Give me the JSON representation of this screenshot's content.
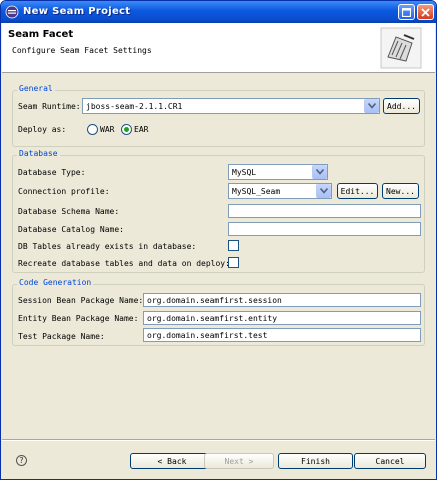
{
  "window": {
    "title": "New Seam Project",
    "header_title": "Seam Facet",
    "header_subtitle": "Configure Seam Facet Settings"
  },
  "general": {
    "legend": "General",
    "runtime_label": "Seam Runtime:",
    "runtime_value": "jboss-seam-2.1.1.CR1",
    "add_label": "Add...",
    "deploy_label": "Deploy as:",
    "deploy_options": [
      "WAR",
      "EAR"
    ],
    "deploy_selected": "EAR"
  },
  "database": {
    "legend": "Database",
    "type_label": "Database Type:",
    "type_value": "MySQL",
    "profile_label": "Connection profile:",
    "profile_value": "MySQL_Seam",
    "edit_label": "Edit...",
    "new_label": "New...",
    "schema_label": "Database Schema Name:",
    "schema_value": "",
    "catalog_label": "Database Catalog Name:",
    "catalog_value": "",
    "tables_exist_label": "DB Tables already exists in database:",
    "tables_exist_checked": false,
    "recreate_label": "Recreate database tables and data on deploy:",
    "recreate_checked": false
  },
  "codegen": {
    "legend": "Code Generation",
    "session_label": "Session Bean Package Name:",
    "session_value": "org.domain.seamfirst.session",
    "entity_label": "Entity Bean Package Name:",
    "entity_value": "org.domain.seamfirst.entity",
    "test_label": "Test Package Name:",
    "test_value": "org.domain.seamfirst.test"
  },
  "footer": {
    "back_label": "< Back",
    "next_label": "Next >",
    "finish_label": "Finish",
    "cancel_label": "Cancel"
  },
  "icons": {
    "title": "eclipse-wizard-icon",
    "header": "seam-facet-wizard-icon",
    "help": "help-icon"
  }
}
